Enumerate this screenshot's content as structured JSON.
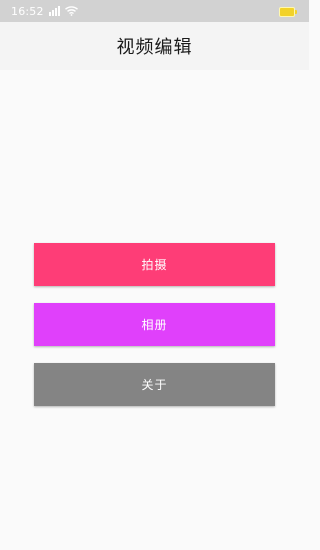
{
  "status_bar": {
    "time": "16:52"
  },
  "header": {
    "title": "视频编辑"
  },
  "buttons": [
    {
      "label": "拍摄",
      "color": "#fe3d77"
    },
    {
      "label": "相册",
      "color": "#e040fb"
    },
    {
      "label": "关于",
      "color": "#848484"
    }
  ],
  "icons": {
    "signal": "signal-icon",
    "wifi": "wifi-icon",
    "battery": "battery-icon"
  }
}
